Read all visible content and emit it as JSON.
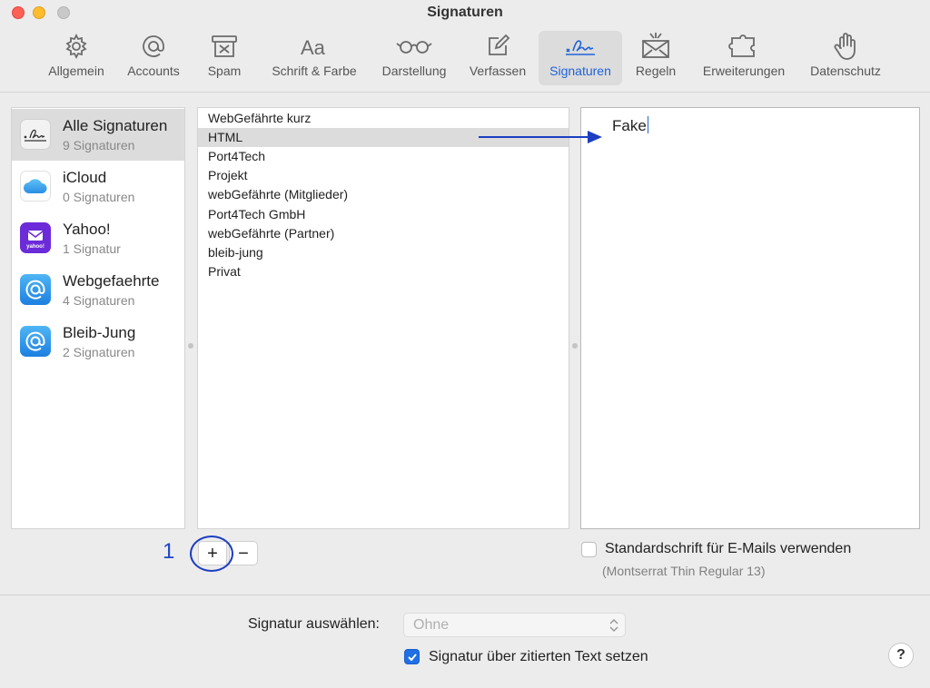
{
  "window": {
    "title": "Signaturen"
  },
  "toolbar": [
    {
      "label": "Allgemein",
      "icon": "gear-icon"
    },
    {
      "label": "Accounts",
      "icon": "at-sign-icon"
    },
    {
      "label": "Spam",
      "icon": "junk-tray-icon"
    },
    {
      "label": "Schrift & Farbe",
      "icon": "font-aa-icon"
    },
    {
      "label": "Darstellung",
      "icon": "glasses-icon"
    },
    {
      "label": "Verfassen",
      "icon": "compose-icon"
    },
    {
      "label": "Signaturen",
      "icon": "signature-icon",
      "active": true
    },
    {
      "label": "Regeln",
      "icon": "rules-envelope-icon"
    },
    {
      "label": "Erweiterungen",
      "icon": "puzzle-icon"
    },
    {
      "label": "Datenschutz",
      "icon": "hand-icon"
    }
  ],
  "accounts": [
    {
      "name": "Alle Signaturen",
      "count": "9 Signaturen",
      "icon": "signature-icon",
      "selected": true
    },
    {
      "name": "iCloud",
      "count": "0 Signaturen",
      "icon": "icloud-icon"
    },
    {
      "name": "Yahoo!",
      "count": "1 Signatur",
      "icon": "yahoo-mail-icon"
    },
    {
      "name": "Webgefaehrte",
      "count": "4 Signaturen",
      "icon": "at-mail-icon"
    },
    {
      "name": "Bleib-Jung",
      "count": "2 Signaturen",
      "icon": "at-mail-icon"
    }
  ],
  "signatures": [
    "WebGefährte kurz",
    "HTML",
    "Port4Tech",
    "Projekt",
    "webGefährte (Mitglieder)",
    "Port4Tech GmbH",
    "webGefährte (Partner)",
    "bleib-jung",
    "Privat"
  ],
  "selected_signature_index": 1,
  "preview": {
    "text": "Fake"
  },
  "annotation": {
    "step_number": "1",
    "color": "#1c3ec2"
  },
  "buttons": {
    "add": "+",
    "remove": "−",
    "help": "?"
  },
  "standard_font": {
    "label": "Standardschrift für E-Mails verwenden",
    "detail": "(Montserrat Thin Regular 13)",
    "checked": false
  },
  "select_signature": {
    "label": "Signatur auswählen:",
    "value": "Ohne"
  },
  "quote_option": {
    "label": "Signatur über zitierten Text setzen",
    "checked": true
  },
  "colors": {
    "accent": "#1f63d8",
    "selected_row": "#dcdcdc"
  }
}
